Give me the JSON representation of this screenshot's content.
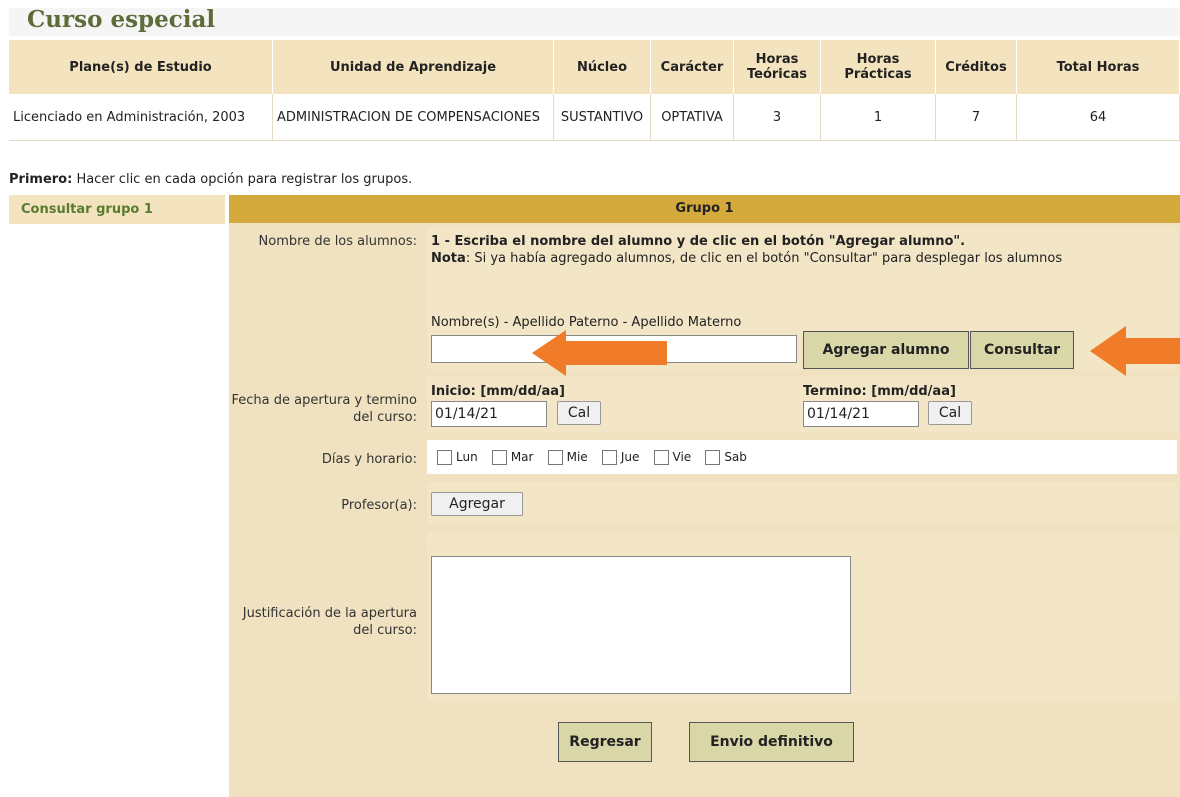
{
  "page": {
    "title": "Curso especial"
  },
  "table": {
    "headers": [
      "Plane(s) de Estudio",
      "Unidad de Aprendizaje",
      "Núcleo",
      "Carácter",
      "Horas Teóricas",
      "Horas Prácticas",
      "Créditos",
      "Total Horas"
    ],
    "row": [
      "Licenciado en Administración, 2003",
      "ADMINISTRACION DE COMPENSACIONES",
      "SUSTANTIVO",
      "OPTATIVA",
      "3",
      "1",
      "7",
      "64"
    ]
  },
  "hint": {
    "bold": "Primero:",
    "text": " Hacer clic en cada opción para registrar los grupos."
  },
  "sidebar": {
    "item": "Consultar grupo 1"
  },
  "panel": {
    "header": "Grupo 1",
    "alumnos": {
      "label": "Nombre de los alumnos:",
      "instruction": "1 - Escriba el nombre del alumno y de clic en el botón \"Agregar alumno\".",
      "note_bold": "Nota",
      "note_text": ": Si ya había agregado alumnos, de clic en el botón \"Consultar\" para desplegar los alumnos",
      "field_label": "Nombre(s) - Apellido Paterno - Apellido Materno",
      "field_value": "",
      "add_button": "Agregar alumno",
      "query_button": "Consultar"
    },
    "fechas": {
      "label": "Fecha de apertura y termino del curso:",
      "start_label": "Inicio: [mm/dd/aa]",
      "start_value": "01/14/21",
      "end_label": "Termino: [mm/dd/aa]",
      "end_value": "01/14/21",
      "cal_button": "Cal"
    },
    "dias": {
      "label": "Días y horario:",
      "days": [
        "Lun",
        "Mar",
        "Mie",
        "Jue",
        "Vie",
        "Sab"
      ]
    },
    "profesor": {
      "label": "Profesor(a):",
      "button": "Agregar"
    },
    "justificacion": {
      "label": "Justificación de la apertura del curso:",
      "value": ""
    },
    "footer": {
      "back_button": "Regresar",
      "submit_button": "Envio definitivo"
    }
  },
  "colors": {
    "accent": "#d4aa3c",
    "panel": "#f0e2c0",
    "arrow": "#f07c2a",
    "title": "#5e6b3a"
  }
}
